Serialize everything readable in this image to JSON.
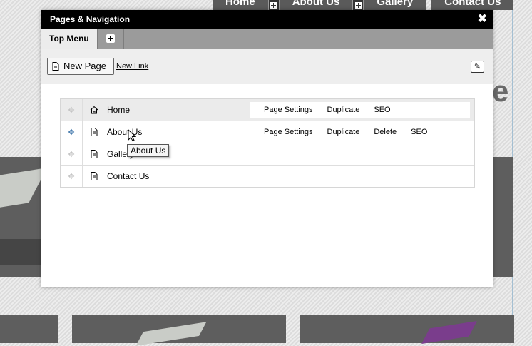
{
  "site_nav": {
    "items": [
      "Home",
      "About Us",
      "Gallery",
      "Contact Us"
    ]
  },
  "dialog": {
    "title": "Pages & Navigation",
    "close_icon": "close-icon",
    "tabs": [
      {
        "label": "Top Menu",
        "active": true
      }
    ],
    "add_tab_icon": "plus-icon",
    "toolbar": {
      "new_page_label": "New Page",
      "new_link_label": "New Link",
      "edit_icon": "pencil-icon"
    },
    "pages": [
      {
        "name": "Home",
        "icon": "home-icon",
        "actions": [
          "Page Settings",
          "Duplicate",
          "SEO"
        ]
      },
      {
        "name": "About Us",
        "icon": "page-icon",
        "actions": [
          "Page Settings",
          "Duplicate",
          "Delete",
          "SEO"
        ]
      },
      {
        "name": "Gallery",
        "icon": "page-icon",
        "actions": []
      },
      {
        "name": "Contact Us",
        "icon": "page-icon",
        "actions": []
      }
    ],
    "tooltip": "About Us"
  },
  "colors": {
    "titlebar": "#000000",
    "tabbar": "#9b9b9b",
    "toolbar": "#eeeeee",
    "accent": "#4c7fb0"
  }
}
